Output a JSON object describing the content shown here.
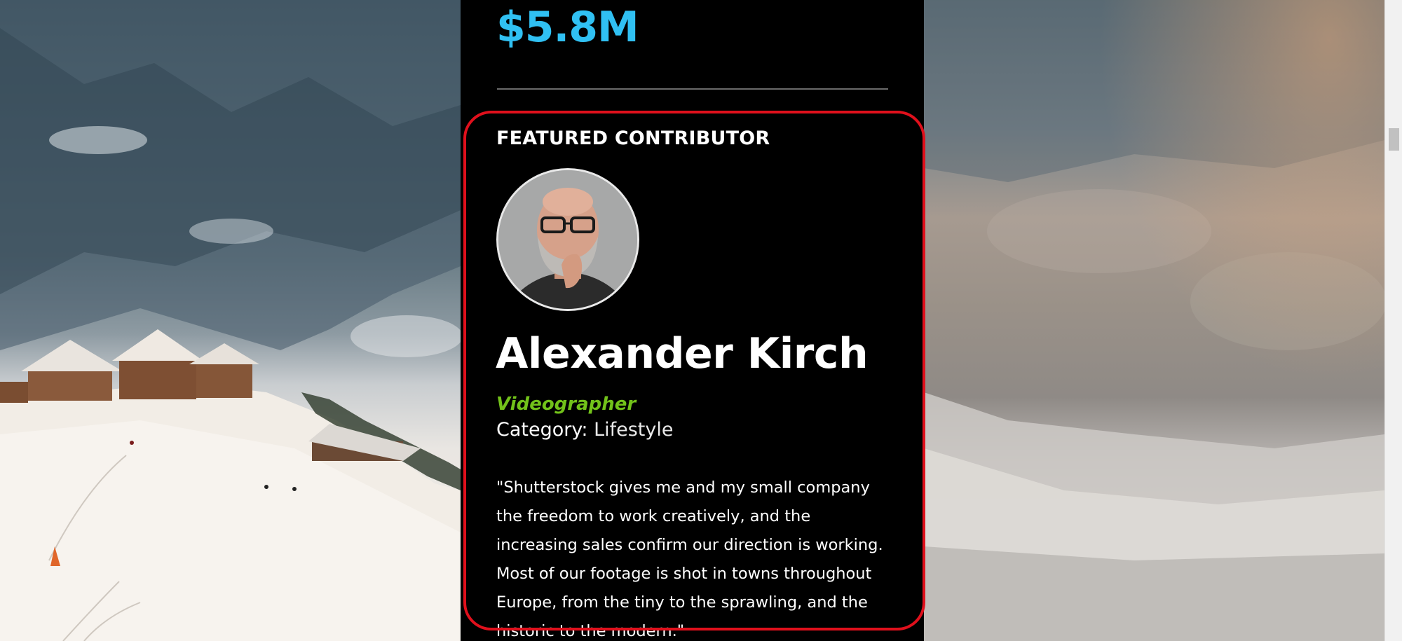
{
  "stat": {
    "value": "$5.8M"
  },
  "featured": {
    "section_label": "FEATURED CONTRIBUTOR",
    "name": "Alexander Kirch",
    "role": "Videographer",
    "category_label": "Category:",
    "category_value": "Lifestyle",
    "quote": "\"Shutterstock gives me and my small company the freedom to work creatively, and the increasing sales confirm our direction is working. Most of our footage is shot in towns throughout Europe, from the tiny to the sprawling, and the historic to the modern.\""
  },
  "colors": {
    "stat_accent": "#30c0f2",
    "role_accent": "#72c21a",
    "highlight_border": "#e0101c",
    "panel_background": "#000000"
  }
}
